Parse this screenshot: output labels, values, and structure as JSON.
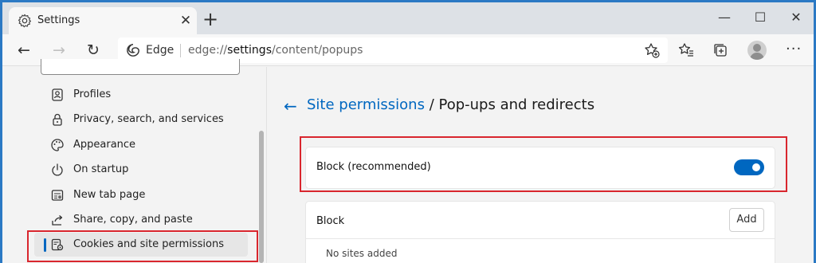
{
  "window": {
    "tab_title": "Settings",
    "tab_close": "✕",
    "new_tab": "+",
    "minimize": "—",
    "maximize": "☐",
    "close": "✕"
  },
  "toolbar": {
    "back": "←",
    "forward": "→",
    "refresh": "↻",
    "edge_label": "Edge",
    "url_prefix": "edge://",
    "url_host": "settings",
    "url_path": "/content/popups",
    "more": "···"
  },
  "sidebar": {
    "items": [
      {
        "label": "Profiles",
        "icon": "profile-icon"
      },
      {
        "label": "Privacy, search, and services",
        "icon": "lock-icon"
      },
      {
        "label": "Appearance",
        "icon": "palette-icon"
      },
      {
        "label": "On startup",
        "icon": "power-icon"
      },
      {
        "label": "New tab page",
        "icon": "new-tab-page-icon"
      },
      {
        "label": "Share, copy, and paste",
        "icon": "share-icon"
      },
      {
        "label": "Cookies and site permissions",
        "icon": "cookies-permissions-icon",
        "active": true
      }
    ]
  },
  "main": {
    "back_arrow": "←",
    "breadcrumb_link": "Site permissions",
    "breadcrumb_sep": " / ",
    "page_title": "Pop-ups and redirects",
    "block_recommended_label": "Block (recommended)",
    "block_recommended_on": true,
    "block_list_title": "Block",
    "add_button": "Add",
    "block_list_empty": "No sites added"
  },
  "colors": {
    "accent": "#0067c0",
    "highlight": "#d9262e",
    "window_border": "#2b79c4"
  }
}
